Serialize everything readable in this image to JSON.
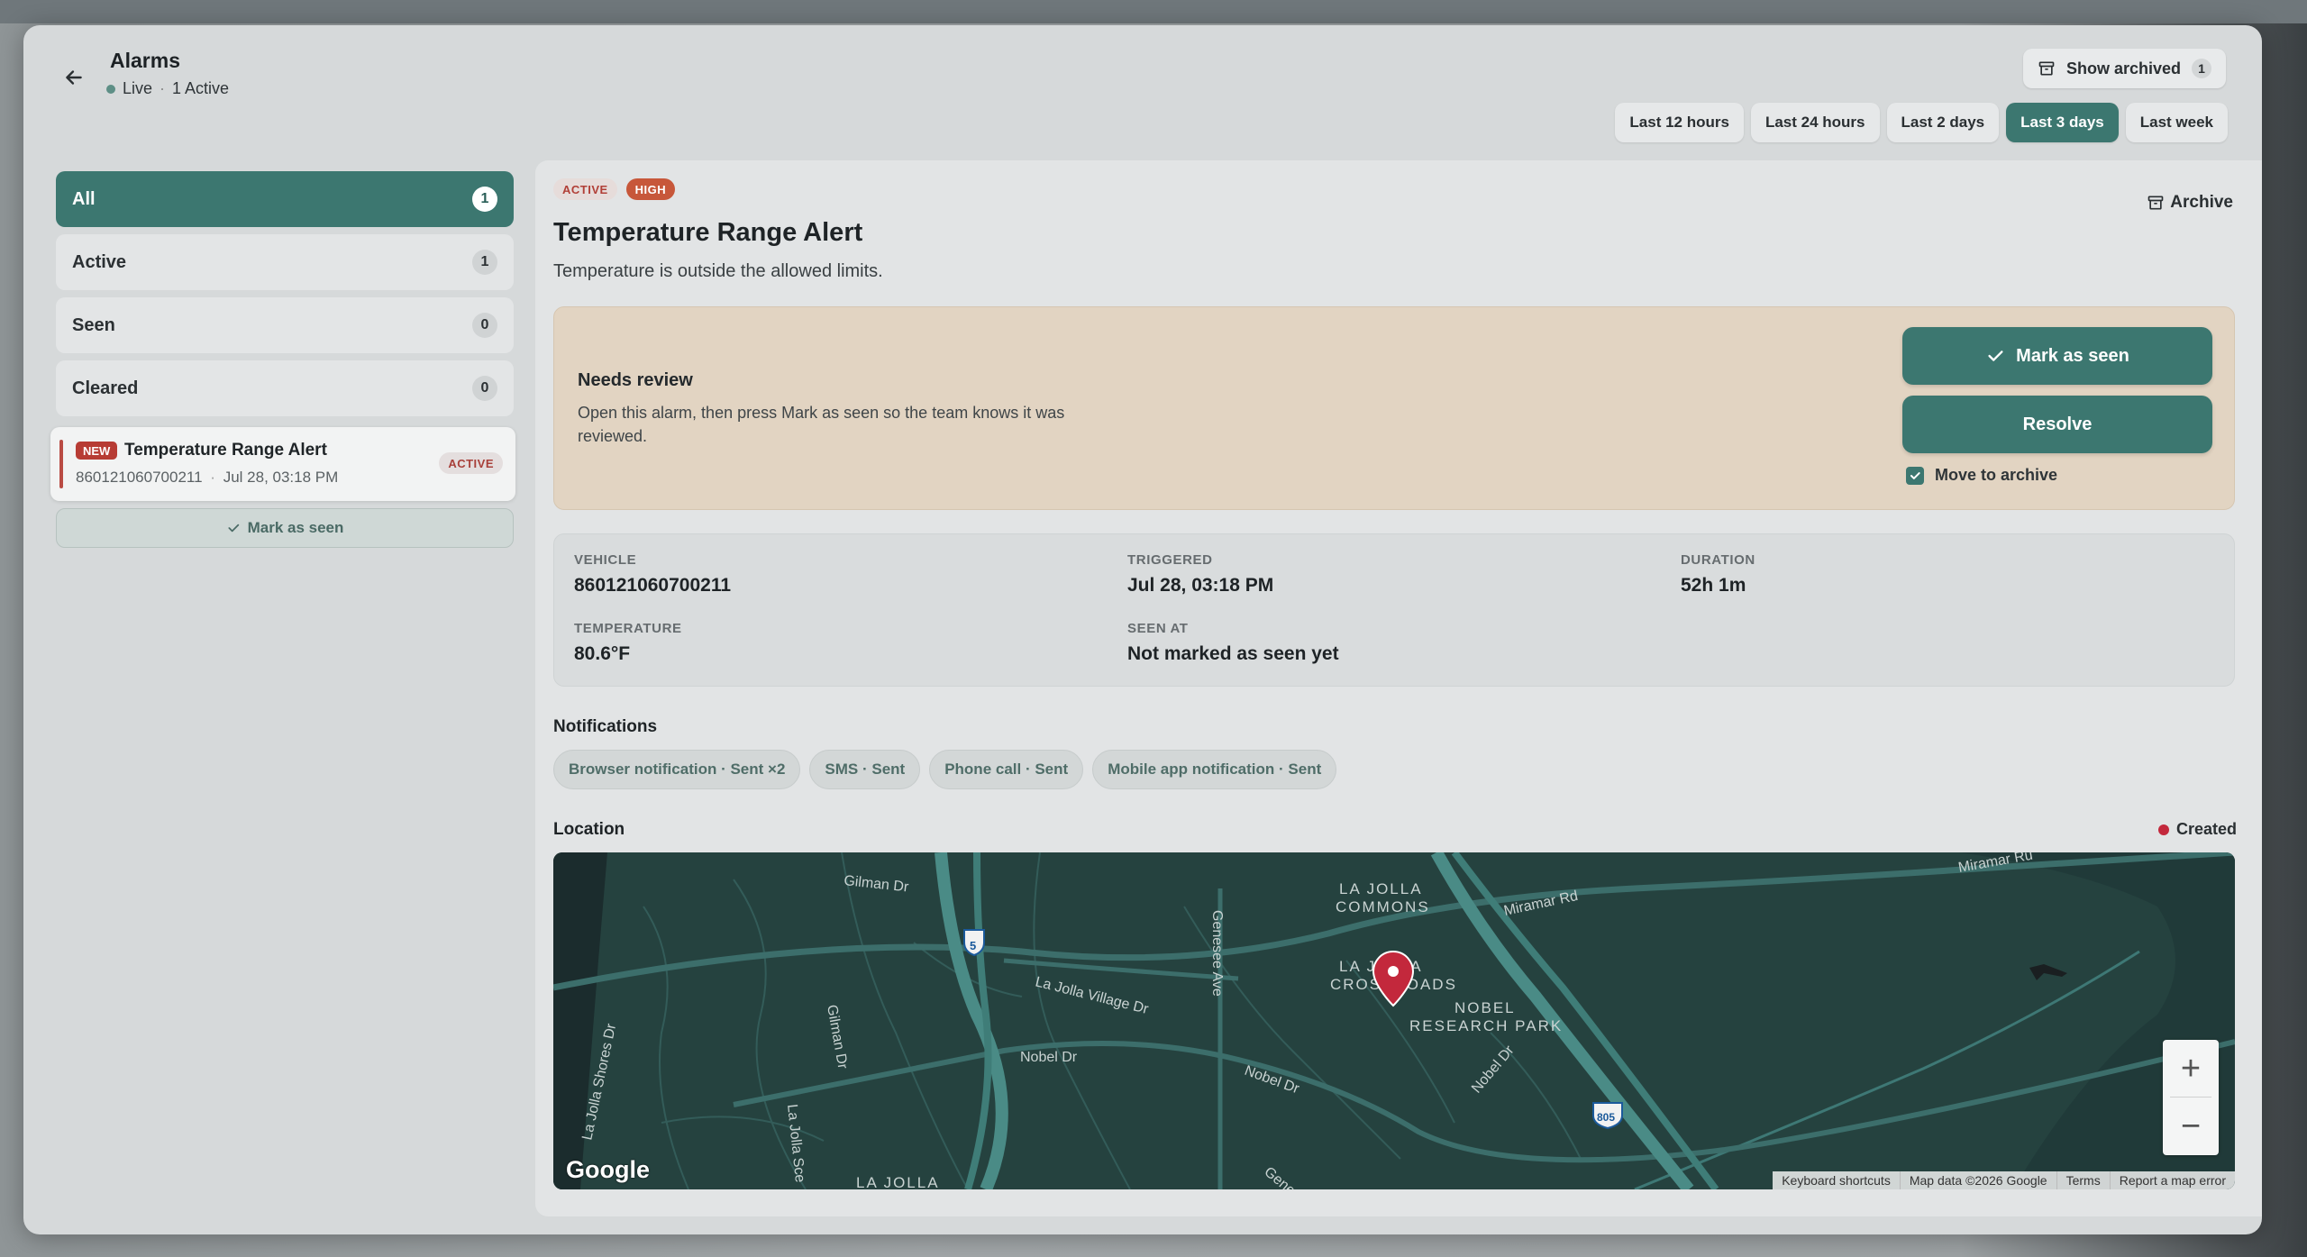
{
  "header": {
    "title": "Alarms",
    "live_label": "Live",
    "separator": "·",
    "active_label": "1 Active",
    "show_archived_label": "Show archived",
    "show_archived_count": "1"
  },
  "time_ranges": [
    {
      "label": "Last 12 hours",
      "selected": false
    },
    {
      "label": "Last 24 hours",
      "selected": false
    },
    {
      "label": "Last 2 days",
      "selected": false
    },
    {
      "label": "Last 3 days",
      "selected": true
    },
    {
      "label": "Last week",
      "selected": false
    }
  ],
  "filters": [
    {
      "label": "All",
      "count": "1",
      "selected": true
    },
    {
      "label": "Active",
      "count": "1",
      "selected": false
    },
    {
      "label": "Seen",
      "count": "0",
      "selected": false
    },
    {
      "label": "Cleared",
      "count": "0",
      "selected": false
    }
  ],
  "alarm_list": [
    {
      "badge": "NEW",
      "title": "Temperature Range Alert",
      "vehicle": "860121060700211",
      "time": "Jul 28, 03:18 PM",
      "status": "ACTIVE",
      "mark_seen_label": "Mark as seen"
    }
  ],
  "detail": {
    "status_badge": "ACTIVE",
    "severity_badge": "HIGH",
    "archive_label": "Archive",
    "title": "Temperature Range Alert",
    "description": "Temperature is outside the allowed limits.",
    "review": {
      "heading": "Needs review",
      "text": "Open this alarm, then press Mark as seen so the team knows it was reviewed.",
      "mark_seen_label": "Mark as seen",
      "resolve_label": "Resolve",
      "move_to_archive_label": "Move to archive",
      "move_to_archive_checked": true
    },
    "fields": {
      "vehicle_label": "VEHICLE",
      "vehicle_value": "860121060700211",
      "triggered_label": "TRIGGERED",
      "triggered_value": "Jul 28, 03:18 PM",
      "duration_label": "DURATION",
      "duration_value": "52h 1m",
      "temperature_label": "TEMPERATURE",
      "temperature_value": "80.6°F",
      "seen_at_label": "SEEN AT",
      "seen_at_value": "Not marked as seen yet"
    },
    "notifications_title": "Notifications",
    "notifications": [
      "Browser notification · Sent ×2",
      "SMS · Sent",
      "Phone call · Sent",
      "Mobile app notification · Sent"
    ],
    "location_title": "Location",
    "legend_created": "Created"
  },
  "map": {
    "labels": {
      "gilman_dr": "Gilman Dr",
      "la_jolla_commons": "LA JOLLA",
      "la_jolla_commons_2": "COMMONS",
      "miramar_rd": "Miramar Rd",
      "miramar_ru": "Miramar Ru",
      "genesee_ave": "Genesee Ave",
      "crossroads_1": "LA JOLLA",
      "crossroads_2": "CROSSROADS",
      "nobel_1": "NOBEL",
      "nobel_2": "RESEARCH PARK",
      "la_jolla_village": "La Jolla Village Dr",
      "gilman_dr_2": "Gilman Dr",
      "nobel_dr": "Nobel Dr",
      "nobel_dr_2": "Nobel Dr",
      "nobel_dr_3": "Nobel Dr",
      "la_jolla_shores": "La Jolla Shores Dr",
      "la_jolla_sce": "La Jolla Sce",
      "la_jolla_bottom": "LA JOLLA",
      "genesee_bottom": "Gene",
      "i5": "5",
      "i805": "805"
    },
    "google_logo": "Google",
    "attribution": [
      "Keyboard shortcuts",
      "Map data ©2026 Google",
      "Terms",
      "Report a map error"
    ],
    "zoom_in": "+",
    "zoom_out": "−"
  },
  "colors": {
    "accent": "#3c7770",
    "alert_red": "#b73c34",
    "high_orange": "#c7573a",
    "review_bg": "#e2d4c2",
    "map_bg": "#24403f",
    "marker": "#c3283c"
  }
}
